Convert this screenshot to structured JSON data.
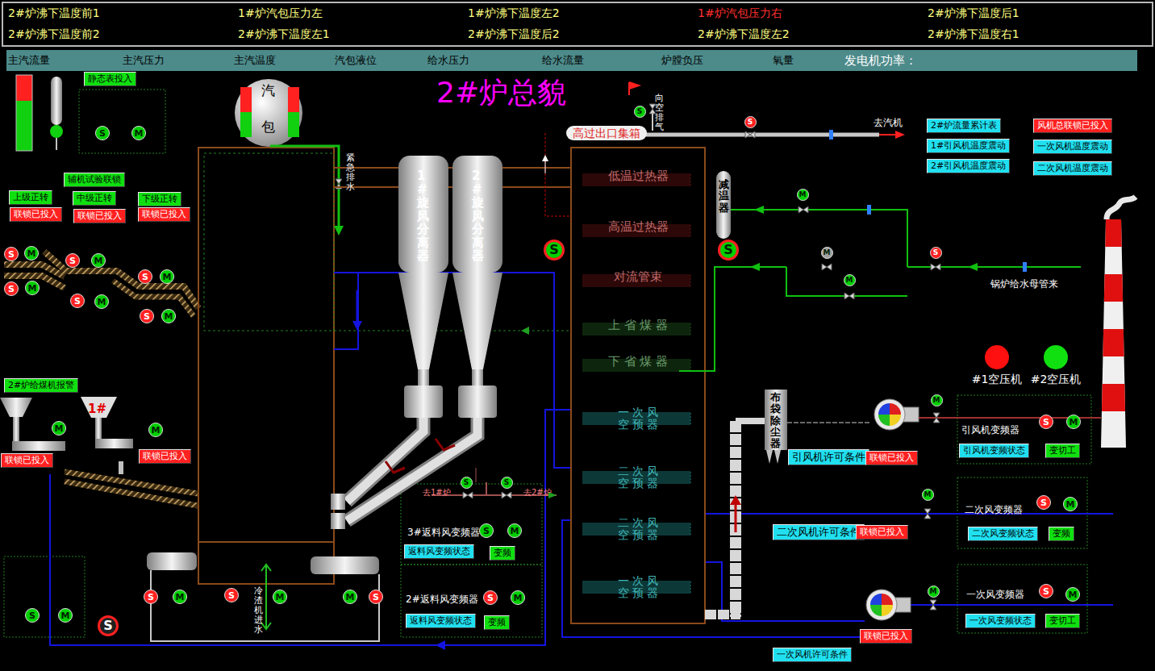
{
  "alarms": [
    {
      "text": "2#炉沸下温度前1",
      "color": "#ffff80"
    },
    {
      "text": "1#炉汽包压力左",
      "color": "#ffff80"
    },
    {
      "text": "1#炉沸下温度左2",
      "color": "#ffff80"
    },
    {
      "text": "1#炉汽包压力右",
      "color": "#ff3030"
    },
    {
      "text": "2#炉沸下温度后1",
      "color": "#ffff80"
    },
    {
      "text": "2#炉沸下温度前2",
      "color": "#ffff80"
    },
    {
      "text": "2#炉沸下温度左1",
      "color": "#ffff80"
    },
    {
      "text": "2#炉沸下温度后2",
      "color": "#ffff80"
    },
    {
      "text": "2#炉沸下温度左2",
      "color": "#ffff80"
    },
    {
      "text": "2#炉沸下温度右1",
      "color": "#ffff80"
    }
  ],
  "params": [
    "主汽流量",
    "主汽压力",
    "主汽温度",
    "汽包液位",
    "给水压力",
    "给水流量",
    "炉膛负压",
    "氧量"
  ],
  "power_label": "发电机功率：",
  "title": "2#炉总貌",
  "level_gauges": [
    {
      "level": 0.66
    },
    {
      "level": 0.5
    },
    {
      "level": 0.5
    }
  ],
  "compressors": [
    {
      "label": "#1空压机",
      "color": "#ff1010"
    },
    {
      "label": "#2空压机",
      "color": "#10e010"
    }
  ],
  "heat_exchangers": [
    {
      "text": "低温过热器",
      "color": "#c06a6a"
    },
    {
      "text": "高温过热器",
      "color": "#c06a6a"
    },
    {
      "text": "对流管束",
      "color": "#c06a6a"
    },
    {
      "text": "上 省 煤 器",
      "color": "#6a9a6a"
    },
    {
      "text": "下 省 煤 器",
      "color": "#6a9a6a"
    }
  ],
  "air_heaters": [
    {
      "top": "一 次 风",
      "bottom": "空 预 器"
    },
    {
      "top": "二 次 风",
      "bottom": "空 预 器"
    },
    {
      "top": "二 次 风",
      "bottom": "空 预 器"
    },
    {
      "top": "一 次 风",
      "bottom": "空 预 器"
    }
  ],
  "labels": [
    {
      "text": "静态表投入",
      "kind": "btn-green"
    },
    {
      "text": "汽包",
      "kind": "drum"
    },
    {
      "text": "紧急排水",
      "kind": "vtext"
    },
    {
      "text": "1#旋风分离器",
      "kind": "vbig"
    },
    {
      "text": "2#旋风分离器",
      "kind": "vbig"
    },
    {
      "text": "向空排气",
      "kind": "vtext"
    },
    {
      "text": "高过出口集箱",
      "kind": "header-box"
    },
    {
      "text": "去汽机",
      "kind": "text"
    },
    {
      "text": "减温器",
      "kind": "vdark"
    },
    {
      "text": "锅炉给水母管来",
      "kind": "text"
    },
    {
      "text": "2#炉流量累计表",
      "kind": "btn-cyan"
    },
    {
      "text": "1#引风机温度震动",
      "kind": "btn-cyan"
    },
    {
      "text": "2#引风机温度震动",
      "kind": "btn-cyan"
    },
    {
      "text": "风机总联锁已投入",
      "kind": "btn-red"
    },
    {
      "text": "一次风机温度震动",
      "kind": "btn-cyan"
    },
    {
      "text": "二次风机温度震动",
      "kind": "btn-cyan"
    },
    {
      "text": "辅机试验联锁",
      "kind": "btn-green"
    },
    {
      "text": "上级正转",
      "kind": "btn-green"
    },
    {
      "text": "中级正转",
      "kind": "btn-green"
    },
    {
      "text": "下级正转",
      "kind": "btn-green"
    },
    {
      "text": "联锁已投入",
      "kind": "btn-red"
    },
    {
      "text": "联锁已投入",
      "kind": "btn-red"
    },
    {
      "text": "联锁已投入",
      "kind": "btn-red"
    },
    {
      "text": "2#炉给煤机报警",
      "kind": "btn-green"
    },
    {
      "text": "1#",
      "kind": "red-mark"
    },
    {
      "text": "联锁已投入",
      "kind": "btn-red"
    },
    {
      "text": "联锁已投入",
      "kind": "btn-red"
    },
    {
      "text": "布袋除尘器",
      "kind": "vdark"
    },
    {
      "text": "引风机许可条件",
      "kind": "btn-cyan-lg"
    },
    {
      "text": "联锁已投入",
      "kind": "btn-red"
    },
    {
      "text": "引风机变频器",
      "kind": "text"
    },
    {
      "text": "引风机变频状态",
      "kind": "btn-cyan"
    },
    {
      "text": "变切工",
      "kind": "btn-green"
    },
    {
      "text": "二次风机许可条件",
      "kind": "btn-cyan-lg"
    },
    {
      "text": "联锁已投入",
      "kind": "btn-red"
    },
    {
      "text": "二次风变频器",
      "kind": "text"
    },
    {
      "text": "二次风变频状态",
      "kind": "btn-cyan"
    },
    {
      "text": "变频",
      "kind": "btn-green"
    },
    {
      "text": "一次风机许可条件",
      "kind": "btn-cyan"
    },
    {
      "text": "联锁已投入",
      "kind": "btn-red"
    },
    {
      "text": "一次风变频器",
      "kind": "text"
    },
    {
      "text": "一次风变频状态",
      "kind": "btn-cyan"
    },
    {
      "text": "变切工",
      "kind": "btn-green"
    },
    {
      "text": "去1#炉",
      "kind": "text-small"
    },
    {
      "text": "去2#炉",
      "kind": "text-small"
    },
    {
      "text": "3#返料风变频器",
      "kind": "text"
    },
    {
      "text": "返料风变频状态",
      "kind": "btn-cyan"
    },
    {
      "text": "变频",
      "kind": "btn-green"
    },
    {
      "text": "2#返料风变频器",
      "kind": "text"
    },
    {
      "text": "返料风变频状态",
      "kind": "btn-cyan"
    },
    {
      "text": "变频",
      "kind": "btn-green"
    },
    {
      "text": "冷渣机进水",
      "kind": "vtext"
    }
  ],
  "markers": [
    {
      "label": "S",
      "color": "#00d000",
      "kind": "plain"
    },
    {
      "label": "M",
      "color": "#00d000",
      "kind": "plain"
    },
    {
      "label": "S",
      "color": "#ff2020",
      "kind": "plain"
    },
    {
      "label": "M",
      "color": "#00d000",
      "kind": "plain"
    },
    {
      "label": "S",
      "color": "#ff2020",
      "kind": "plain"
    },
    {
      "label": "M",
      "color": "#00d000",
      "kind": "plain"
    },
    {
      "label": "S",
      "color": "#ff2020",
      "kind": "plain"
    },
    {
      "label": "M",
      "color": "#00d000",
      "kind": "plain"
    },
    {
      "label": "S",
      "color": "#ff2020",
      "kind": "plain"
    },
    {
      "label": "M",
      "color": "#00d000",
      "kind": "plain"
    },
    {
      "label": "S",
      "color": "#ff2020",
      "kind": "plain"
    },
    {
      "label": "M",
      "color": "#00d000",
      "kind": "plain"
    },
    {
      "label": "S",
      "color": "#ff2020",
      "kind": "plain"
    },
    {
      "label": "M",
      "color": "#00d000",
      "kind": "plain"
    },
    {
      "label": "S",
      "color": "#00d000",
      "kind": "ring"
    },
    {
      "label": "S",
      "color": "#00d000",
      "kind": "ring"
    },
    {
      "label": "S",
      "color": "#00d000",
      "kind": "small"
    },
    {
      "label": "M",
      "color": "#00d000",
      "kind": "small"
    },
    {
      "label": "M",
      "color": "#a0a0a0",
      "kind": "small"
    },
    {
      "label": "M",
      "color": "#00d000",
      "kind": "small"
    },
    {
      "label": "M",
      "color": "#00d000",
      "kind": "plain"
    },
    {
      "label": "M",
      "color": "#00d000",
      "kind": "plain"
    },
    {
      "label": "S",
      "color": "#00d000",
      "kind": "small"
    },
    {
      "label": "S",
      "color": "#00d000",
      "kind": "small"
    },
    {
      "label": "S",
      "color": "#00d000",
      "kind": "plain"
    },
    {
      "label": "M",
      "color": "#00d000",
      "kind": "plain"
    },
    {
      "label": "S",
      "color": "#ff2020",
      "kind": "plain"
    },
    {
      "label": "M",
      "color": "#00d000",
      "kind": "plain"
    },
    {
      "label": "S",
      "color": "#ff2020",
      "kind": "plain"
    },
    {
      "label": "M",
      "color": "#00d000",
      "kind": "plain"
    },
    {
      "label": "S",
      "color": "#ff2020",
      "kind": "plain"
    },
    {
      "label": "M",
      "color": "#00d000",
      "kind": "plain"
    },
    {
      "label": "M",
      "color": "#00d000",
      "kind": "plain"
    },
    {
      "label": "S",
      "color": "#ff2020",
      "kind": "plain"
    },
    {
      "label": "S",
      "color": "#00d000",
      "kind": "plain"
    },
    {
      "label": "M",
      "color": "#00d000",
      "kind": "plain"
    },
    {
      "label": "S",
      "color": "#202020",
      "kind": "ring"
    },
    {
      "label": "M",
      "color": "#00d000",
      "kind": "small"
    },
    {
      "label": "S",
      "color": "#ff2020",
      "kind": "plain"
    },
    {
      "label": "M",
      "color": "#00d000",
      "kind": "plain"
    },
    {
      "label": "M",
      "color": "#00d000",
      "kind": "small"
    },
    {
      "label": "S",
      "color": "#ff2020",
      "kind": "plain"
    },
    {
      "label": "M",
      "color": "#00d000",
      "kind": "plain"
    },
    {
      "label": "M",
      "color": "#00d000",
      "kind": "small"
    },
    {
      "label": "S",
      "color": "#ff2020",
      "kind": "plain"
    },
    {
      "label": "M",
      "color": "#00d000",
      "kind": "plain"
    },
    {
      "label": "S",
      "color": "#ff2020",
      "kind": "small"
    },
    {
      "label": "S",
      "color": "#ff2020",
      "kind": "small"
    }
  ]
}
